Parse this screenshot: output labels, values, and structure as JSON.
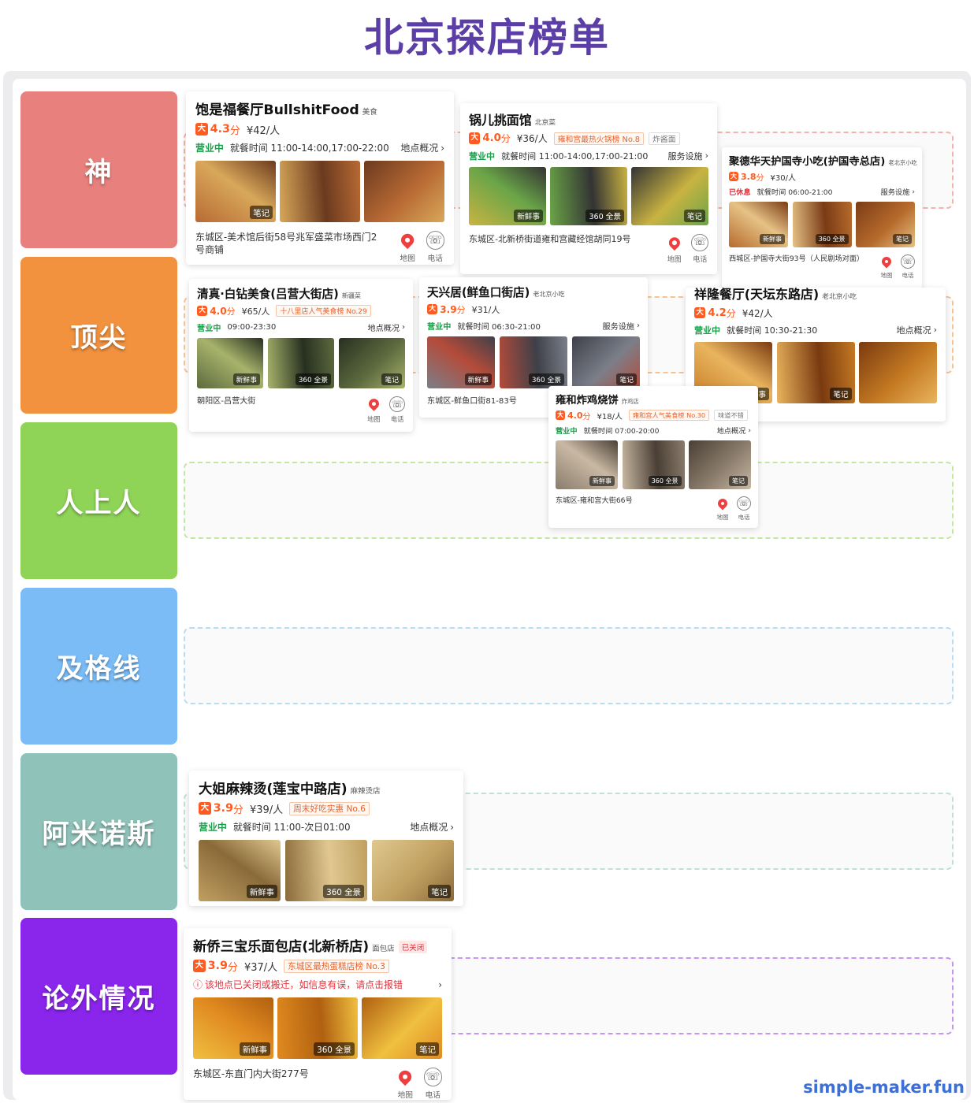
{
  "page_title": "北京探店榜单",
  "watermark": "simple-maker.fun",
  "tiers": [
    {
      "label": "神",
      "color": "#e8817e",
      "zone_border": "#f5b3a8"
    },
    {
      "label": "顶尖",
      "color": "#f2913e",
      "zone_border": "#f7c28e"
    },
    {
      "label": "人上人",
      "color": "#8fd357",
      "zone_border": "#c3e79f"
    },
    {
      "label": "及格线",
      "color": "#7bbcf7",
      "zone_border": "#b7dcf8"
    },
    {
      "label": "阿米诺斯",
      "color": "#8fc2b9",
      "zone_border": "#c0dfd6"
    },
    {
      "label": "论外情况",
      "color": "#8a25ec",
      "zone_border": "#c893f2"
    }
  ],
  "common": {
    "score_unit": "分",
    "logo": "大",
    "map_label": "地图",
    "phone_label": "电话",
    "phone_icon": "☏",
    "chevron": "›",
    "warn_icon": "ⓘ",
    "tag_fresh": "新鲜事",
    "tag_360": "360 全景",
    "tag_note": "笔记"
  },
  "shops": [
    {
      "name": "饱是福餐厅BullshitFood",
      "category": "美食",
      "score": "4.3",
      "price": "¥42/人",
      "status": "营业中",
      "hours": "就餐时间 11:00-14:00,17:00-22:00",
      "link": "地点概况",
      "photo_tags": [
        "笔记",
        "",
        ""
      ],
      "address": "东城区-美术馆后街58号兆军盛菜市场西门2号商铺"
    },
    {
      "name": "锅儿挑面馆",
      "category": "北京菜",
      "score": "4.0",
      "price": "¥36/人",
      "badge": "雍和宫最热火锅榜 No.8",
      "badge2": "炸酱面",
      "status": "营业中",
      "hours": "就餐时间 11:00-14:00,17:00-21:00",
      "link": "服务设施",
      "photo_tags": [
        "新鲜事",
        "360 全景",
        "笔记"
      ],
      "address": "东城区-北新桥街道雍和宫藏经馆胡同19号"
    },
    {
      "name": "聚德华天护国寺小吃(护国寺总店)",
      "category": "老北京小吃",
      "score": "3.8",
      "price": "¥30/人",
      "status": "已休息",
      "hours": "就餐时间 06:00-21:00",
      "link": "服务设施",
      "photo_tags": [
        "新鲜事",
        "360 全景",
        "笔记"
      ],
      "address": "西城区-护国寺大街93号（人民剧场对面）"
    },
    {
      "name": "清真·白钻美食(吕营大街店)",
      "category": "新疆菜",
      "score": "4.0",
      "price": "¥65/人",
      "badge": "十八里店人气美食榜 No.29",
      "status": "营业中",
      "hours": "09:00-23:30",
      "link": "地点概况",
      "photo_tags": [
        "新鲜事",
        "360 全景",
        "笔记"
      ],
      "address": "朝阳区-吕营大街"
    },
    {
      "name": "天兴居(鲜鱼口街店)",
      "category": "老北京小吃",
      "score": "3.9",
      "price": "¥31/人",
      "status": "营业中",
      "hours": "就餐时间 06:30-21:00",
      "link": "服务设施",
      "photo_tags": [
        "新鲜事",
        "360 全景",
        "笔记"
      ],
      "address": "东城区-鲜鱼口街81-83号"
    },
    {
      "name": "祥隆餐厅(天坛东路店)",
      "category": "老北京小吃",
      "score": "4.2",
      "price": "¥42/人",
      "status": "营业中",
      "hours": "就餐时间 10:30-21:30",
      "link": "地点概况",
      "photo_tags": [
        "新鲜事",
        "笔记",
        ""
      ],
      "address": ""
    },
    {
      "name": "雍和炸鸡烧饼",
      "category": "炸鸡店",
      "score": "4.0",
      "price": "¥18/人",
      "badge": "雍和宫人气美食榜 No.30",
      "badge2": "味道不错",
      "status": "营业中",
      "hours": "就餐时间 07:00-20:00",
      "link": "地点概况",
      "photo_tags": [
        "新鲜事",
        "360 全景",
        "笔记"
      ],
      "address": "东城区-雍和宫大街66号"
    },
    {
      "name": "大姐麻辣烫(莲宝中路店)",
      "category": "麻辣烫店",
      "score": "3.9",
      "price": "¥39/人",
      "badge": "周末好吃实惠 No.6",
      "status": "营业中",
      "hours": "就餐时间 11:00-次日01:00",
      "link": "地点概况",
      "photo_tags": [
        "新鲜事",
        "360 全景",
        "笔记"
      ],
      "address": ""
    },
    {
      "name": "新侨三宝乐面包店(北新桥店)",
      "category": "面包店",
      "closed": "已关闭",
      "score": "3.9",
      "price": "¥37/人",
      "badge": "东城区最热蛋糕店榜 No.3",
      "warning": "该地点已关闭或搬迁，如信息有误，请点击报错",
      "photo_tags": [
        "新鲜事",
        "360 全景",
        "笔记"
      ],
      "address": "东城区-东直门内大街277号"
    }
  ]
}
